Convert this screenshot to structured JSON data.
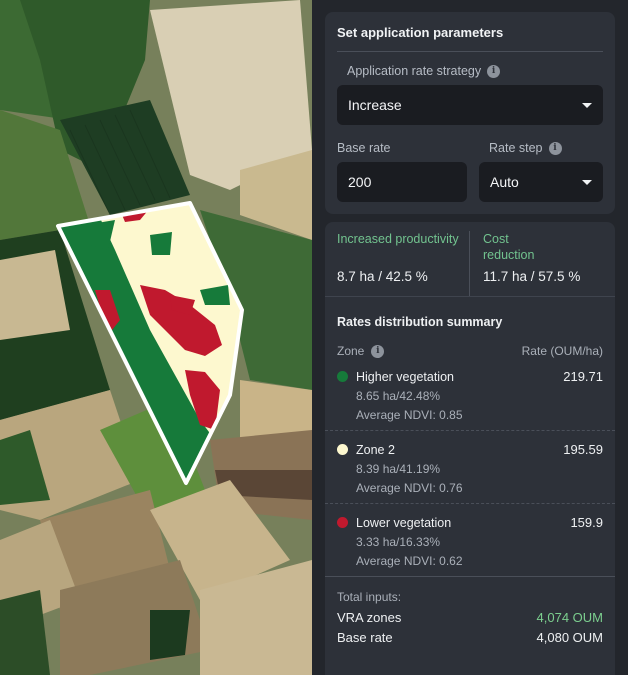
{
  "params": {
    "title": "Set application parameters",
    "strategy_label": "Application rate strategy",
    "strategy_value": "Increase",
    "base_rate_label": "Base rate",
    "base_rate_value": "200",
    "rate_step_label": "Rate step",
    "rate_step_value": "Auto"
  },
  "kpis": [
    {
      "label": "Increased productivity",
      "value": "8.7 ha / 42.5 %"
    },
    {
      "label": "Cost reduction",
      "value": "11.7 ha / 57.5 %"
    }
  ],
  "summary": {
    "title": "Rates distribution summary",
    "zone_col": "Zone",
    "rate_col": "Rate (OUM/ha)",
    "zones": [
      {
        "name": "Higher vegetation",
        "area": "8.65 ha/42.48%",
        "ndvi": "Average NDVI: 0.85",
        "rate": "219.71",
        "color": "#167a3a"
      },
      {
        "name": "Zone 2",
        "area": "8.39 ha/41.19%",
        "ndvi": "Average NDVI: 0.76",
        "rate": "195.59",
        "color": "#fdf8cf"
      },
      {
        "name": "Lower vegetation",
        "area": "3.33 ha/16.33%",
        "ndvi": "Average NDVI: 0.62",
        "rate": "159.9",
        "color": "#c0192e"
      }
    ],
    "totals_label": "Total inputs:",
    "vra_label": "VRA zones",
    "vra_value": "4,074 OUM",
    "base_label": "Base rate",
    "base_value": "4,080 OUM"
  },
  "colors": {
    "accent_green": "#7ccf8f",
    "zone_high": "#167a3a",
    "zone_mid": "#fdf8cf",
    "zone_low": "#c0192e"
  }
}
